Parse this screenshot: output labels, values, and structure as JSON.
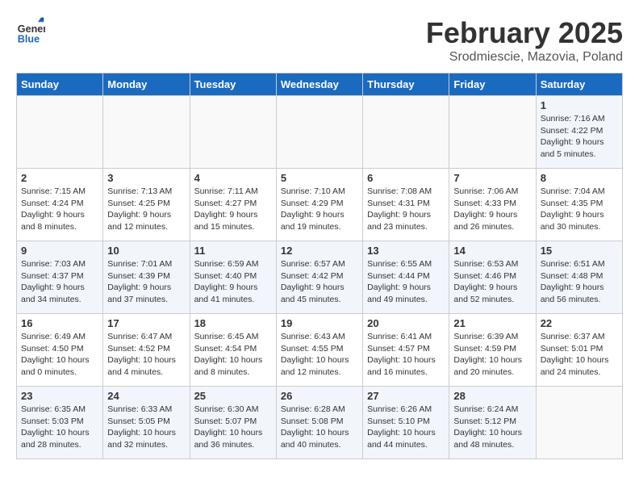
{
  "header": {
    "logo_general": "General",
    "logo_blue": "Blue",
    "month_title": "February 2025",
    "location": "Srodmiescie, Mazovia, Poland"
  },
  "weekdays": [
    "Sunday",
    "Monday",
    "Tuesday",
    "Wednesday",
    "Thursday",
    "Friday",
    "Saturday"
  ],
  "weeks": [
    [
      {
        "day": "",
        "info": ""
      },
      {
        "day": "",
        "info": ""
      },
      {
        "day": "",
        "info": ""
      },
      {
        "day": "",
        "info": ""
      },
      {
        "day": "",
        "info": ""
      },
      {
        "day": "",
        "info": ""
      },
      {
        "day": "1",
        "info": "Sunrise: 7:16 AM\nSunset: 4:22 PM\nDaylight: 9 hours and 5 minutes."
      }
    ],
    [
      {
        "day": "2",
        "info": "Sunrise: 7:15 AM\nSunset: 4:24 PM\nDaylight: 9 hours and 8 minutes."
      },
      {
        "day": "3",
        "info": "Sunrise: 7:13 AM\nSunset: 4:25 PM\nDaylight: 9 hours and 12 minutes."
      },
      {
        "day": "4",
        "info": "Sunrise: 7:11 AM\nSunset: 4:27 PM\nDaylight: 9 hours and 15 minutes."
      },
      {
        "day": "5",
        "info": "Sunrise: 7:10 AM\nSunset: 4:29 PM\nDaylight: 9 hours and 19 minutes."
      },
      {
        "day": "6",
        "info": "Sunrise: 7:08 AM\nSunset: 4:31 PM\nDaylight: 9 hours and 23 minutes."
      },
      {
        "day": "7",
        "info": "Sunrise: 7:06 AM\nSunset: 4:33 PM\nDaylight: 9 hours and 26 minutes."
      },
      {
        "day": "8",
        "info": "Sunrise: 7:04 AM\nSunset: 4:35 PM\nDaylight: 9 hours and 30 minutes."
      }
    ],
    [
      {
        "day": "9",
        "info": "Sunrise: 7:03 AM\nSunset: 4:37 PM\nDaylight: 9 hours and 34 minutes."
      },
      {
        "day": "10",
        "info": "Sunrise: 7:01 AM\nSunset: 4:39 PM\nDaylight: 9 hours and 37 minutes."
      },
      {
        "day": "11",
        "info": "Sunrise: 6:59 AM\nSunset: 4:40 PM\nDaylight: 9 hours and 41 minutes."
      },
      {
        "day": "12",
        "info": "Sunrise: 6:57 AM\nSunset: 4:42 PM\nDaylight: 9 hours and 45 minutes."
      },
      {
        "day": "13",
        "info": "Sunrise: 6:55 AM\nSunset: 4:44 PM\nDaylight: 9 hours and 49 minutes."
      },
      {
        "day": "14",
        "info": "Sunrise: 6:53 AM\nSunset: 4:46 PM\nDaylight: 9 hours and 52 minutes."
      },
      {
        "day": "15",
        "info": "Sunrise: 6:51 AM\nSunset: 4:48 PM\nDaylight: 9 hours and 56 minutes."
      }
    ],
    [
      {
        "day": "16",
        "info": "Sunrise: 6:49 AM\nSunset: 4:50 PM\nDaylight: 10 hours and 0 minutes."
      },
      {
        "day": "17",
        "info": "Sunrise: 6:47 AM\nSunset: 4:52 PM\nDaylight: 10 hours and 4 minutes."
      },
      {
        "day": "18",
        "info": "Sunrise: 6:45 AM\nSunset: 4:54 PM\nDaylight: 10 hours and 8 minutes."
      },
      {
        "day": "19",
        "info": "Sunrise: 6:43 AM\nSunset: 4:55 PM\nDaylight: 10 hours and 12 minutes."
      },
      {
        "day": "20",
        "info": "Sunrise: 6:41 AM\nSunset: 4:57 PM\nDaylight: 10 hours and 16 minutes."
      },
      {
        "day": "21",
        "info": "Sunrise: 6:39 AM\nSunset: 4:59 PM\nDaylight: 10 hours and 20 minutes."
      },
      {
        "day": "22",
        "info": "Sunrise: 6:37 AM\nSunset: 5:01 PM\nDaylight: 10 hours and 24 minutes."
      }
    ],
    [
      {
        "day": "23",
        "info": "Sunrise: 6:35 AM\nSunset: 5:03 PM\nDaylight: 10 hours and 28 minutes."
      },
      {
        "day": "24",
        "info": "Sunrise: 6:33 AM\nSunset: 5:05 PM\nDaylight: 10 hours and 32 minutes."
      },
      {
        "day": "25",
        "info": "Sunrise: 6:30 AM\nSunset: 5:07 PM\nDaylight: 10 hours and 36 minutes."
      },
      {
        "day": "26",
        "info": "Sunrise: 6:28 AM\nSunset: 5:08 PM\nDaylight: 10 hours and 40 minutes."
      },
      {
        "day": "27",
        "info": "Sunrise: 6:26 AM\nSunset: 5:10 PM\nDaylight: 10 hours and 44 minutes."
      },
      {
        "day": "28",
        "info": "Sunrise: 6:24 AM\nSunset: 5:12 PM\nDaylight: 10 hours and 48 minutes."
      },
      {
        "day": "",
        "info": ""
      }
    ]
  ]
}
